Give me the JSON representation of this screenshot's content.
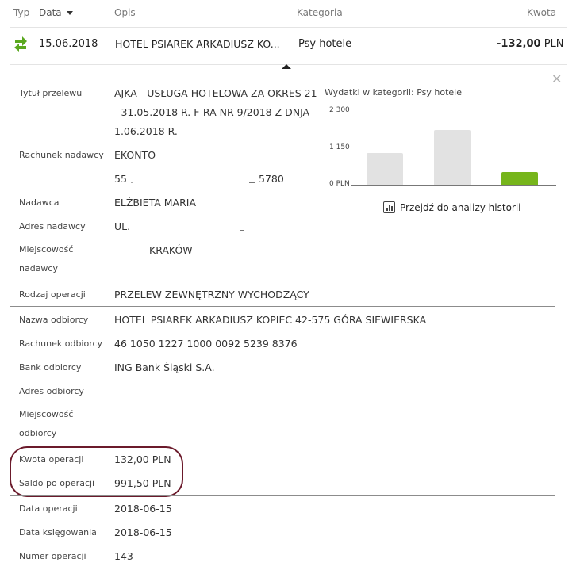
{
  "header": {
    "type_label": "Typ",
    "date_label": "Data",
    "desc_label": "Opis",
    "category_label": "Kategoria",
    "amount_label": "Kwota"
  },
  "transaction": {
    "icon": "transfer-arrows-icon",
    "date": "15.06.2018",
    "description": "HOTEL PSIAREK ARKADIUSZ KO...",
    "category": "Psy hotele",
    "amount_value": "-132,00",
    "amount_currency": "PLN"
  },
  "details": {
    "title_label": "Tytuł przelewu",
    "title_value": "AJKA - USŁUGA HOTELOWA ZA OKRES 21 - 31.05.2018 R. F-RA NR 9/2018 Z DNJA 1.06.2018 R.",
    "sender_account_label": "Rachunek nadawcy",
    "sender_account_name": "EKONTO",
    "sender_account_number_start": "55",
    "sender_account_number_end": "5780",
    "sender_label": "Nadawca",
    "sender_value": "ELŻBIETA MARIA",
    "sender_address_label": "Adres nadawcy",
    "sender_address_value": "UL.",
    "sender_city_label": "Miejscowość nadawcy",
    "sender_city_value": "KRAKÓW",
    "operation_type_label": "Rodzaj operacji",
    "operation_type_value": "PRZELEW ZEWNĘTRZNY WYCHODZĄCY",
    "recipient_name_label": "Nazwa odbiorcy",
    "recipient_name_value": "HOTEL PSIAREK ARKADIUSZ KOPIEC 42-575 GÓRA SIEWIERSKA",
    "recipient_account_label": "Rachunek odbiorcy",
    "recipient_account_value": "46 1050 1227 1000 0092 5239 8376",
    "recipient_bank_label": "Bank odbiorcy",
    "recipient_bank_value": "ING Bank Śląski S.A.",
    "recipient_address_label": "Adres odbiorcy",
    "recipient_city_label": "Miejscowość odbiorcy",
    "op_amount_label": "Kwota operacji",
    "op_amount_value": "132,00 PLN",
    "balance_label": "Saldo po operacji",
    "balance_value": "991,50 PLN",
    "op_date_label": "Data operacji",
    "op_date_value": "2018-06-15",
    "booking_date_label": "Data księgowania",
    "booking_date_value": "2018-06-15",
    "op_number_label": "Numer operacji",
    "op_number_value": "143"
  },
  "chart_data": {
    "type": "bar",
    "title": "Wydatki w kategorii:  Psy hotele",
    "y_ticks": [
      "2 300",
      "1 150",
      "0 PLN"
    ],
    "ylim": [
      0,
      2300
    ],
    "values": [
      1000,
      1700,
      400
    ],
    "bar_colors": [
      "#e2e2e2",
      "#e2e2e2",
      "#76b51b"
    ]
  },
  "analysis_link": "Przejdź do analizy historii",
  "colors": {
    "accent_green": "#76b51b",
    "highlight_border": "#6b1a2b"
  }
}
